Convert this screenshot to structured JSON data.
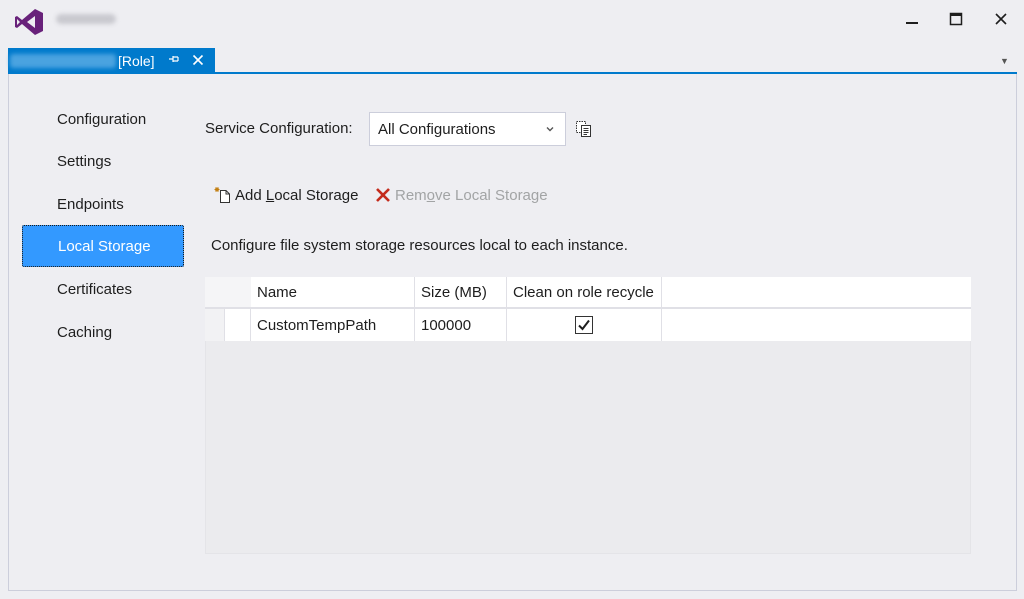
{
  "window": {
    "tab_label": "[Role]",
    "pin_glyph": "⊣",
    "close_glyph": "✕"
  },
  "controls": {
    "minimize_glyph": "▁",
    "maximize_glyph": "☐",
    "close_glyph": "✕"
  },
  "nav": {
    "items": [
      {
        "label": "Configuration"
      },
      {
        "label": "Settings"
      },
      {
        "label": "Endpoints"
      },
      {
        "label": "Local Storage"
      },
      {
        "label": "Certificates"
      },
      {
        "label": "Caching"
      }
    ],
    "active": "Local Storage"
  },
  "service_config": {
    "label_pre": "Service Confi",
    "label_u": "g",
    "label_post": "uration:",
    "selected": "All Configurations"
  },
  "toolbar": {
    "add_pre": "Add ",
    "add_u": "L",
    "add_post": "ocal Storage",
    "remove_pre": "Rem",
    "remove_u": "o",
    "remove_post": "ve Local Storage"
  },
  "description": "Configure file system storage resources local to each instance.",
  "table": {
    "columns": [
      "Name",
      "Size (MB)",
      "Clean on role recycle"
    ],
    "rows": [
      {
        "name": "CustomTempPath",
        "size": "100000",
        "clean": true
      }
    ]
  },
  "colors": {
    "accent": "#007acc",
    "selection": "#3399ff",
    "logo": "#68217a"
  }
}
